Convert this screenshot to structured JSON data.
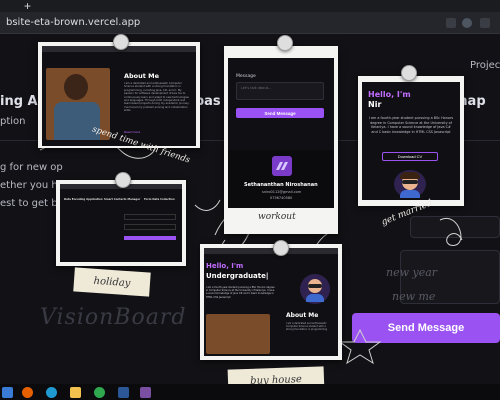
{
  "browser": {
    "url": "bsite-eta-brown.vercel.app",
    "new_tab": "+"
  },
  "background": {
    "title_left": "ing Appli",
    "title_mid": "ebas",
    "title_right": "map",
    "subtitle": "ption",
    "projects": "Project",
    "line1": "g for new op",
    "line2": "ether you have",
    "line3": "est to get bac",
    "send_button": "Send Message",
    "ghost1": "new year",
    "ghost2": "new me"
  },
  "vision_board": "VisionBoard",
  "cards": {
    "about": {
      "heading": "About Me",
      "text": "I am a dedicated and enthusiastic Computer Science student with a strong foundation in programming, including Java, C#, and C. My passion for software development drives me to continuously learn and adapt to new technologies and languages. Through both independent and team-based projects during my academic journey, I've honed my problem-solving and collaboration skills.",
      "read_more": "Read more",
      "caption": "spend time with friends"
    },
    "contact": {
      "message_label": "Message",
      "message_placeholder": "Let's talk about...",
      "send_label": "Send Message",
      "name": "Sethananthan Niroshanan",
      "email": "sniro0112@gmail.com",
      "phone": "0756740580",
      "caption": "workout"
    },
    "hello": {
      "hello": "Hello, I'm",
      "typed": "Nir",
      "text": "I am a fourth-year student pursuing a BSc Honors degree in Computer Science at the University of Kelaniya. I have a sound knowledge of Java C# and C basic knowledge in HTML CSS Javascript",
      "download": "Download CV",
      "caption": "get married"
    },
    "holiday": {
      "col1": "Data Encoding Application",
      "col2": "Smart Contacts Manager",
      "col3": "Form Data Collection",
      "caption": "holiday"
    },
    "buy": {
      "hello": "Hello, I'm",
      "typed": "Undergraduate|",
      "text": "I am a fourth-year student pursuing a BSc Honors degree in Computer Science at the University of Kelaniya. I have a sound knowledge of Java C# and C basic knowledge in HTML CSS Javascript",
      "about": "About Me",
      "about_text": "I am a dedicated and enthusiastic Computer Science student with a strong foundation in programming",
      "caption": "buy house"
    }
  },
  "colors": {
    "accent": "#9b52f2",
    "hello": "#c26cff"
  }
}
